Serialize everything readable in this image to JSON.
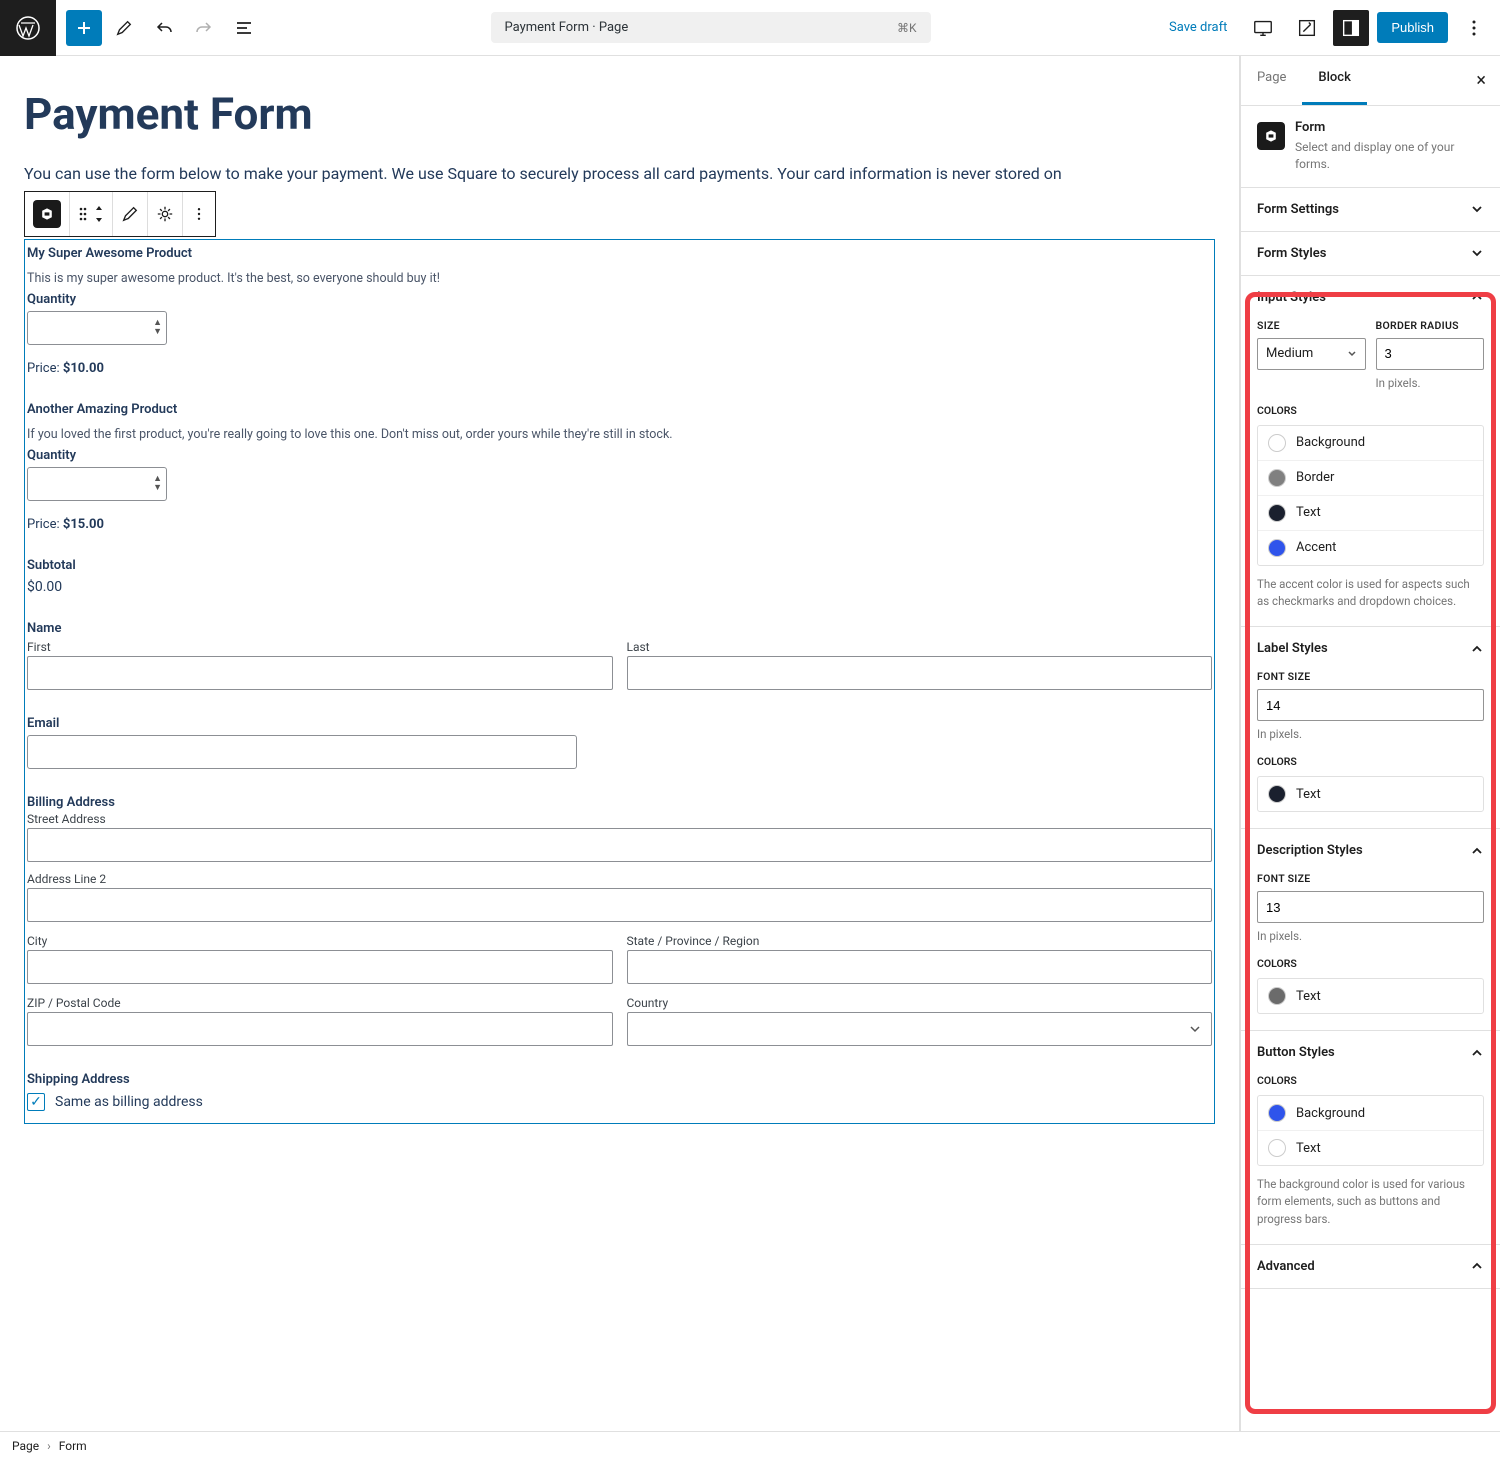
{
  "topbar": {
    "doc_title": "Payment Form · Page",
    "shortcut": "⌘K",
    "save_draft": "Save draft",
    "publish": "Publish"
  },
  "editor": {
    "title": "Payment Form",
    "intro": "You can use the form below to make your payment. We use Square to securely process all card payments. Your card information is never stored on",
    "products": [
      {
        "title": "My Super Awesome Product",
        "desc": "This is my super awesome product. It's the best, so everyone should buy it!",
        "qty_label": "Quantity",
        "price_label": "Price:",
        "price_value": "$10.00"
      },
      {
        "title": "Another Amazing Product",
        "desc": "If you loved the first product, you're really going to love this one. Don't miss out, order yours while they're still in stock.",
        "qty_label": "Quantity",
        "price_label": "Price:",
        "price_value": "$15.00"
      }
    ],
    "subtotal_label": "Subtotal",
    "subtotal_value": "$0.00",
    "name_label": "Name",
    "first_label": "First",
    "last_label": "Last",
    "email_label": "Email",
    "billing_label": "Billing Address",
    "street_label": "Street Address",
    "line2_label": "Address Line 2",
    "city_label": "City",
    "state_label": "State / Province / Region",
    "zip_label": "ZIP / Postal Code",
    "country_label": "Country",
    "shipping_label": "Shipping Address",
    "same_as_billing": "Same as billing address"
  },
  "sidebar": {
    "tabs": {
      "page": "Page",
      "block": "Block"
    },
    "block": {
      "title": "Form",
      "desc": "Select and display one of your forms."
    },
    "panels": {
      "form_settings": "Form Settings",
      "form_styles": "Form Styles",
      "input_styles": {
        "title": "Input Styles",
        "size_label": "SIZE",
        "size_value": "Medium",
        "radius_label": "BORDER RADIUS",
        "radius_value": "3",
        "radius_hint": "In pixels.",
        "colors_label": "COLORS",
        "colors": [
          {
            "name": "Background",
            "hex": "#ffffff"
          },
          {
            "name": "Border",
            "hex": "#808080"
          },
          {
            "name": "Text",
            "hex": "#1a202e"
          },
          {
            "name": "Accent",
            "hex": "#2f54eb"
          }
        ],
        "help": "The accent color is used for aspects such as checkmarks and dropdown choices."
      },
      "label_styles": {
        "title": "Label Styles",
        "font_size_label": "FONT SIZE",
        "font_size_value": "14",
        "hint": "In pixels.",
        "colors_label": "COLORS",
        "colors": [
          {
            "name": "Text",
            "hex": "#1a202e"
          }
        ]
      },
      "description_styles": {
        "title": "Description Styles",
        "font_size_label": "FONT SIZE",
        "font_size_value": "13",
        "hint": "In pixels.",
        "colors_label": "COLORS",
        "colors": [
          {
            "name": "Text",
            "hex": "#6b6b6b"
          }
        ]
      },
      "button_styles": {
        "title": "Button Styles",
        "colors_label": "COLORS",
        "colors": [
          {
            "name": "Background",
            "hex": "#2f54eb"
          },
          {
            "name": "Text",
            "hex": "#ffffff"
          }
        ],
        "help": "The background color is used for various form elements, such as buttons and progress bars."
      },
      "advanced": "Advanced"
    }
  },
  "footer": {
    "page": "Page",
    "form": "Form"
  }
}
